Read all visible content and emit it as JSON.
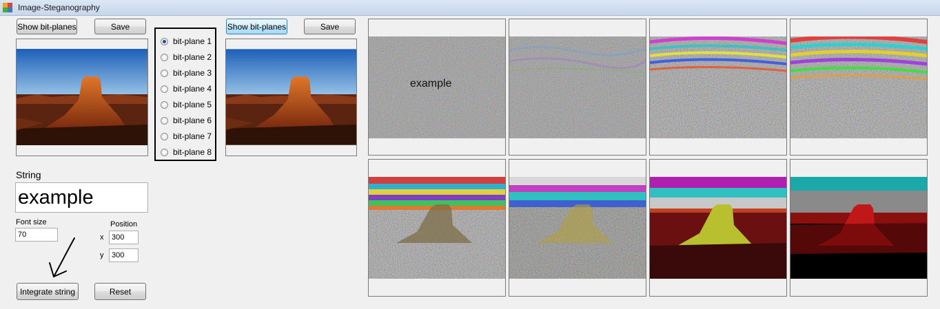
{
  "window": {
    "title": "Image-Steganography"
  },
  "left_panel": {
    "show_label": "Show bit-planes",
    "save_label": "Save"
  },
  "right_panel": {
    "show_label": "Show bit-planes",
    "save_label": "Save"
  },
  "bitplanes": {
    "selected": "bit-plane 1",
    "options": [
      "bit-plane 1",
      "bit-plane 2",
      "bit-plane 3",
      "bit-plane 4",
      "bit-plane 5",
      "bit-plane 6",
      "bit-plane 7",
      "bit-plane 8"
    ]
  },
  "string_section": {
    "label": "String",
    "value": "example",
    "font_size_label": "Font size",
    "font_size_value": "70",
    "position_label": "Position",
    "x_label": "x",
    "x_value": "300",
    "y_label": "y",
    "y_value": "300",
    "integrate_label": "Integrate string",
    "reset_label": "Reset"
  },
  "plane_overlay_text": "example"
}
